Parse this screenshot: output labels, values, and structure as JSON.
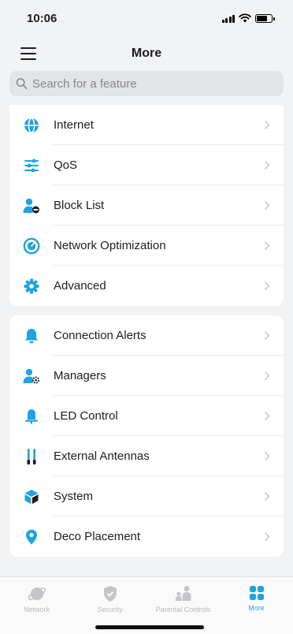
{
  "status": {
    "time": "10:06"
  },
  "header": {
    "title": "More"
  },
  "search": {
    "placeholder": "Search for a feature"
  },
  "colors": {
    "accent": "#1fa3e1",
    "chevron": "#c7c7cc",
    "tab_inactive": "#c4c5c9"
  },
  "group1": [
    {
      "label": "Internet",
      "icon": "globe-icon"
    },
    {
      "label": "QoS",
      "icon": "sliders-icon"
    },
    {
      "label": "Block List",
      "icon": "user-block-icon"
    },
    {
      "label": "Network Optimization",
      "icon": "optimization-icon"
    },
    {
      "label": "Advanced",
      "icon": "gear-icon"
    }
  ],
  "group2": [
    {
      "label": "Connection Alerts",
      "icon": "bell-icon"
    },
    {
      "label": "Managers",
      "icon": "user-gear-icon"
    },
    {
      "label": "LED Control",
      "icon": "led-icon"
    },
    {
      "label": "External Antennas",
      "icon": "antenna-icon"
    },
    {
      "label": "System",
      "icon": "cube-icon"
    },
    {
      "label": "Deco Placement",
      "icon": "location-pin-icon"
    }
  ],
  "tabbar": {
    "tabs": [
      {
        "label": "Network",
        "icon": "network-icon",
        "active": false
      },
      {
        "label": "Security",
        "icon": "shield-icon",
        "active": false
      },
      {
        "label": "Parental Controls",
        "icon": "family-icon",
        "active": false
      },
      {
        "label": "More",
        "icon": "grid-icon",
        "active": true
      }
    ]
  }
}
